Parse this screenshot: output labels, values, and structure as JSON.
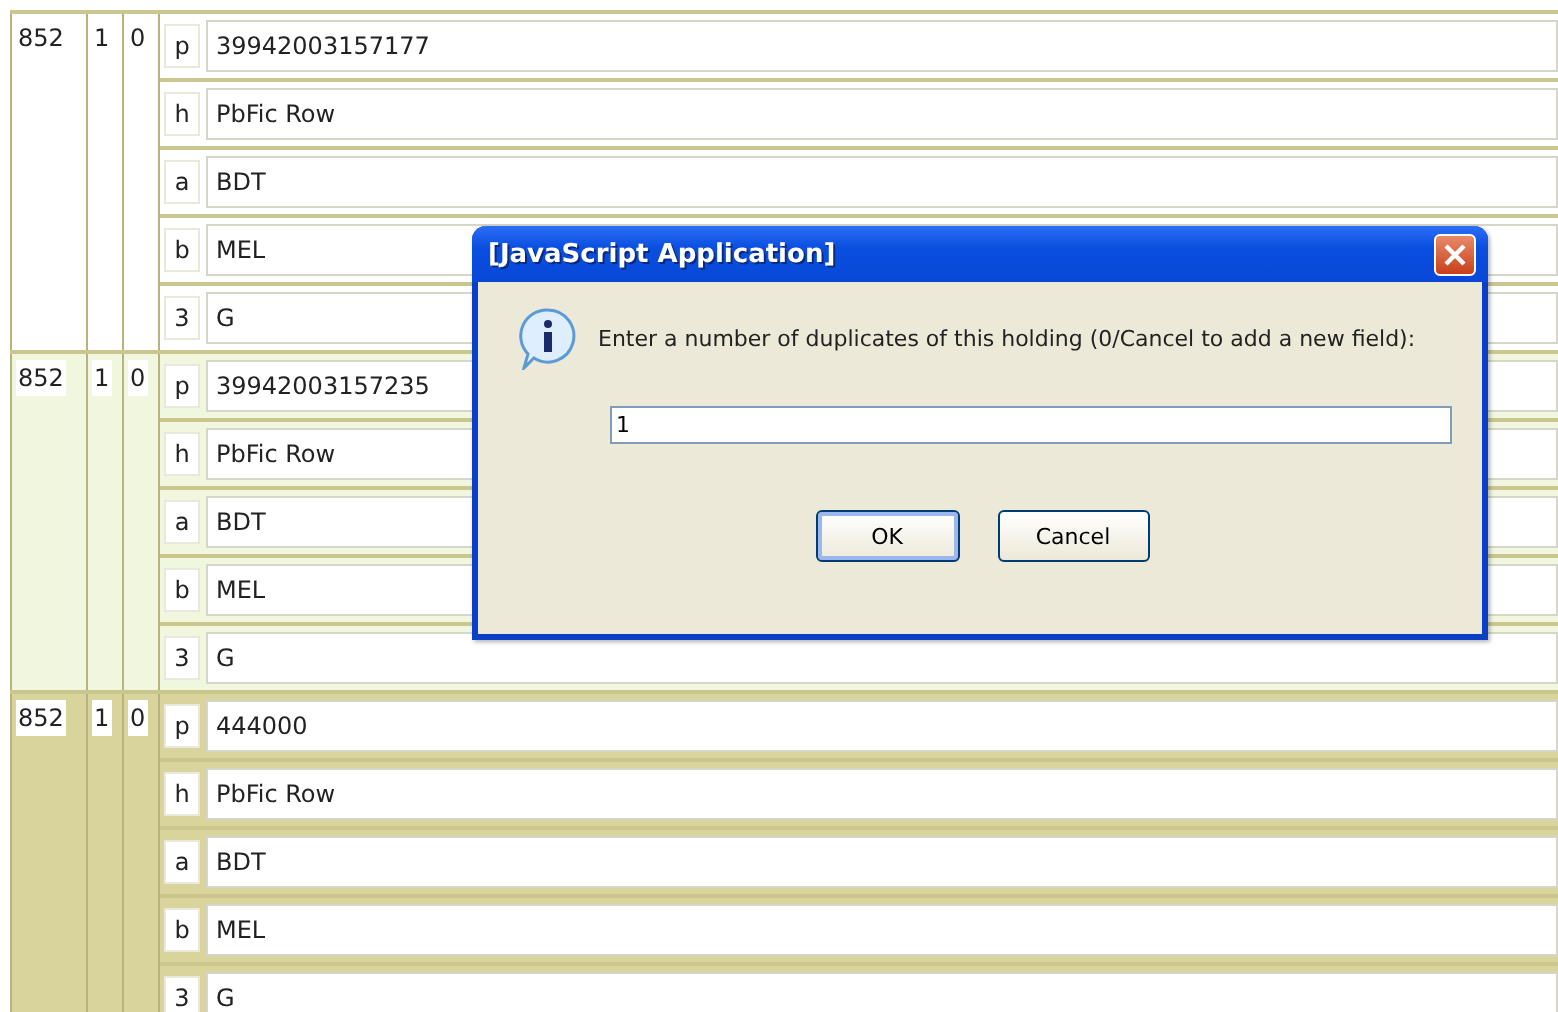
{
  "fields": [
    {
      "tag": "852",
      "ind1": "1",
      "ind2": "0",
      "color": "#ffffff",
      "subfields": [
        {
          "code": "p",
          "value": "39942003157177"
        },
        {
          "code": "h",
          "value": "PbFic Row"
        },
        {
          "code": "a",
          "value": "BDT"
        },
        {
          "code": "b",
          "value": "MEL"
        },
        {
          "code": "3",
          "value": "G"
        }
      ]
    },
    {
      "tag": "852",
      "ind1": "1",
      "ind2": "0",
      "color": "#f1f6df",
      "subfields": [
        {
          "code": "p",
          "value": "39942003157235"
        },
        {
          "code": "h",
          "value": "PbFic Row"
        },
        {
          "code": "a",
          "value": "BDT"
        },
        {
          "code": "b",
          "value": "MEL"
        },
        {
          "code": "3",
          "value": "G"
        }
      ]
    },
    {
      "tag": "852",
      "ind1": "1",
      "ind2": "0",
      "color": "#d9d49c",
      "subfields": [
        {
          "code": "p",
          "value": "444000"
        },
        {
          "code": "h",
          "value": "PbFic Row"
        },
        {
          "code": "a",
          "value": "BDT"
        },
        {
          "code": "b",
          "value": "MEL"
        },
        {
          "code": "3",
          "value": "G"
        }
      ]
    }
  ],
  "dialog": {
    "title": "[JavaScript Application]",
    "message": "Enter a number of duplicates of this holding (0/Cancel to add a new field):",
    "value": "1",
    "buttons": [
      {
        "label": "OK",
        "selected": true
      },
      {
        "label": "Cancel",
        "selected": false
      }
    ]
  }
}
